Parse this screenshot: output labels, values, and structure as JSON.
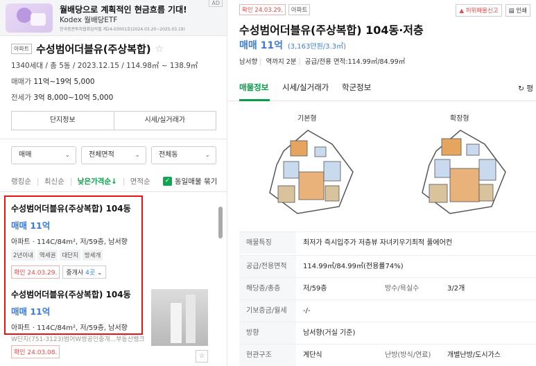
{
  "ad": {
    "title": "월배당으로 계획적인 현금흐름 기대!",
    "subtitle": "Kodex 월배당ETF",
    "fine_print": "한국증권투자협회심의필 제24-03001호(2024.03.20~2025.03.19)",
    "badge": "AD"
  },
  "complex": {
    "type_tag": "아파트",
    "name": "수성범어더블유(주상복합)",
    "meta": "1340세대 / 총 5동 / 2023.12.15 / 114.98㎡ ~ 138.9㎡",
    "sale_label": "매매가",
    "sale_value": "11억~19억 5,000",
    "jeonse_label": "전세가",
    "jeonse_value": "3억 8,000~10억 5,000",
    "buttons": [
      "단지정보",
      "시세/실거래가"
    ]
  },
  "filters": [
    "매매",
    "전체면적",
    "전체동"
  ],
  "sort": {
    "options": [
      "랭킹순",
      "최신순",
      "낮은가격순↓",
      "면적순"
    ],
    "active_index": 2,
    "same_listing_label": "동일매물 묶기",
    "same_listing_checked": true
  },
  "listings": [
    {
      "name": "수성범어더블유(주상복합) 104동",
      "price": "매매 11억",
      "spec": "아파트 · 114C/84m², 저/59층, 남서향",
      "tags": [
        "2년이내",
        "역세권",
        "대단지",
        "방세개"
      ],
      "confirmed": "확인 24.03.29.",
      "agent_label": "중개사",
      "agent_count": "4곳"
    },
    {
      "name": "수성범어더블유(주상복합) 104동",
      "price": "매매 11억",
      "spec": "아파트 · 114C/84m², 저/59층, 남서향",
      "sub": "W단지(751-3123)범어W쌍공인중개...부동산뱅크",
      "confirmed": "확인 24.03.08."
    }
  ],
  "detail": {
    "confirmed": "확인 24.03.29.",
    "type": "아파트",
    "actions": [
      "허위매물신고",
      "인쇄"
    ],
    "title": "수성범어더블유(주상복합) 104동·저층",
    "price": "매매 11억",
    "price_per": "(3,163만원/3.3㎡)",
    "meta": [
      "남서향",
      "역까지 2분",
      "공급/전용 면적:114.99㎡/84.99㎡"
    ],
    "tabs": [
      "매물정보",
      "시세/실거래가",
      "학군정보"
    ],
    "active_tab": 0,
    "refresh": "평",
    "floorplans": [
      "기본형",
      "확장형"
    ],
    "info_rows": [
      {
        "label": "매물특징",
        "value": "최저가 즉시입주가 저층뷰 자녀키우기최적 풀에어컨"
      },
      {
        "label": "공급/전용면적",
        "value": "114.99㎡/84.99㎡(전용률74%)"
      },
      {
        "label": "해당층/총층",
        "value": "저/59층",
        "label2": "방수/욕실수",
        "value2": "3/2개"
      },
      {
        "label": "기보증금/월세",
        "value": "-/-"
      },
      {
        "label": "방향",
        "value": "남서향(거실 기준)"
      },
      {
        "label": "현관구조",
        "value": "계단식",
        "label2": "난방(방식/연료)",
        "value2": "개별난방/도시가스"
      }
    ]
  },
  "colors": {
    "accent_green": "#0a9c49",
    "price_blue": "#3b7be0",
    "confirm_red": "#e14b4b",
    "highlight_red": "#e11111"
  }
}
